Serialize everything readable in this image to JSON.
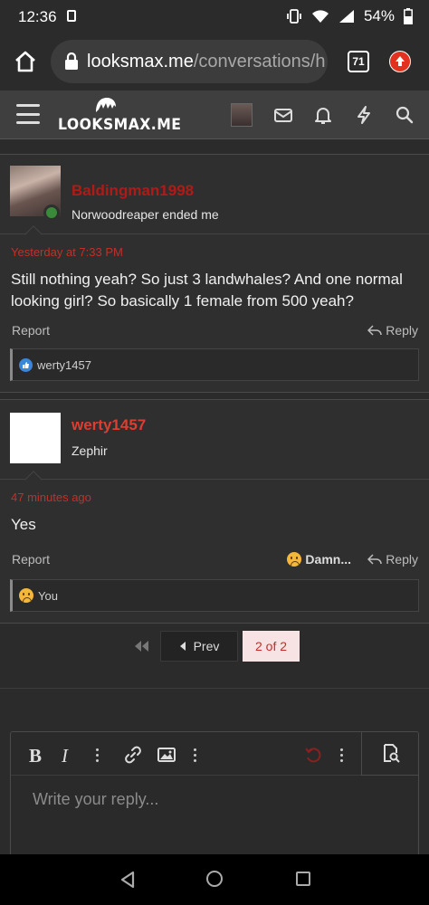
{
  "status_bar": {
    "time": "12:36",
    "battery": "54%"
  },
  "browser": {
    "domain": "looksmax.me",
    "path": "/conversations/h",
    "tab_count": "71"
  },
  "site": {
    "logo_text": "LOOKSMAX.ME"
  },
  "messages": [
    {
      "username": "Baldingman1998",
      "user_title": "Norwoodreaper ended me",
      "timestamp": "Yesterday at 7:33 PM",
      "body": "Still nothing yeah? So just 3 landwhales? And one normal looking girl? So basically 1 female from 500 yeah?",
      "report_label": "Report",
      "reply_label": "Reply",
      "reaction_user": "werty1457"
    },
    {
      "username": "werty1457",
      "user_title": "Zephir",
      "timestamp": "47 minutes ago",
      "body": "Yes",
      "report_label": "Report",
      "reply_label": "Reply",
      "reaction_label": "Damn...",
      "reaction_user": "You"
    }
  ],
  "pagination": {
    "prev_label": "Prev",
    "current": "2 of 2"
  },
  "editor": {
    "bold": "B",
    "italic": "I",
    "placeholder": "Write your reply..."
  },
  "colors": {
    "accent": "#c0302b",
    "bg": "#2b2b2b",
    "nav": "#3f3f3f"
  }
}
